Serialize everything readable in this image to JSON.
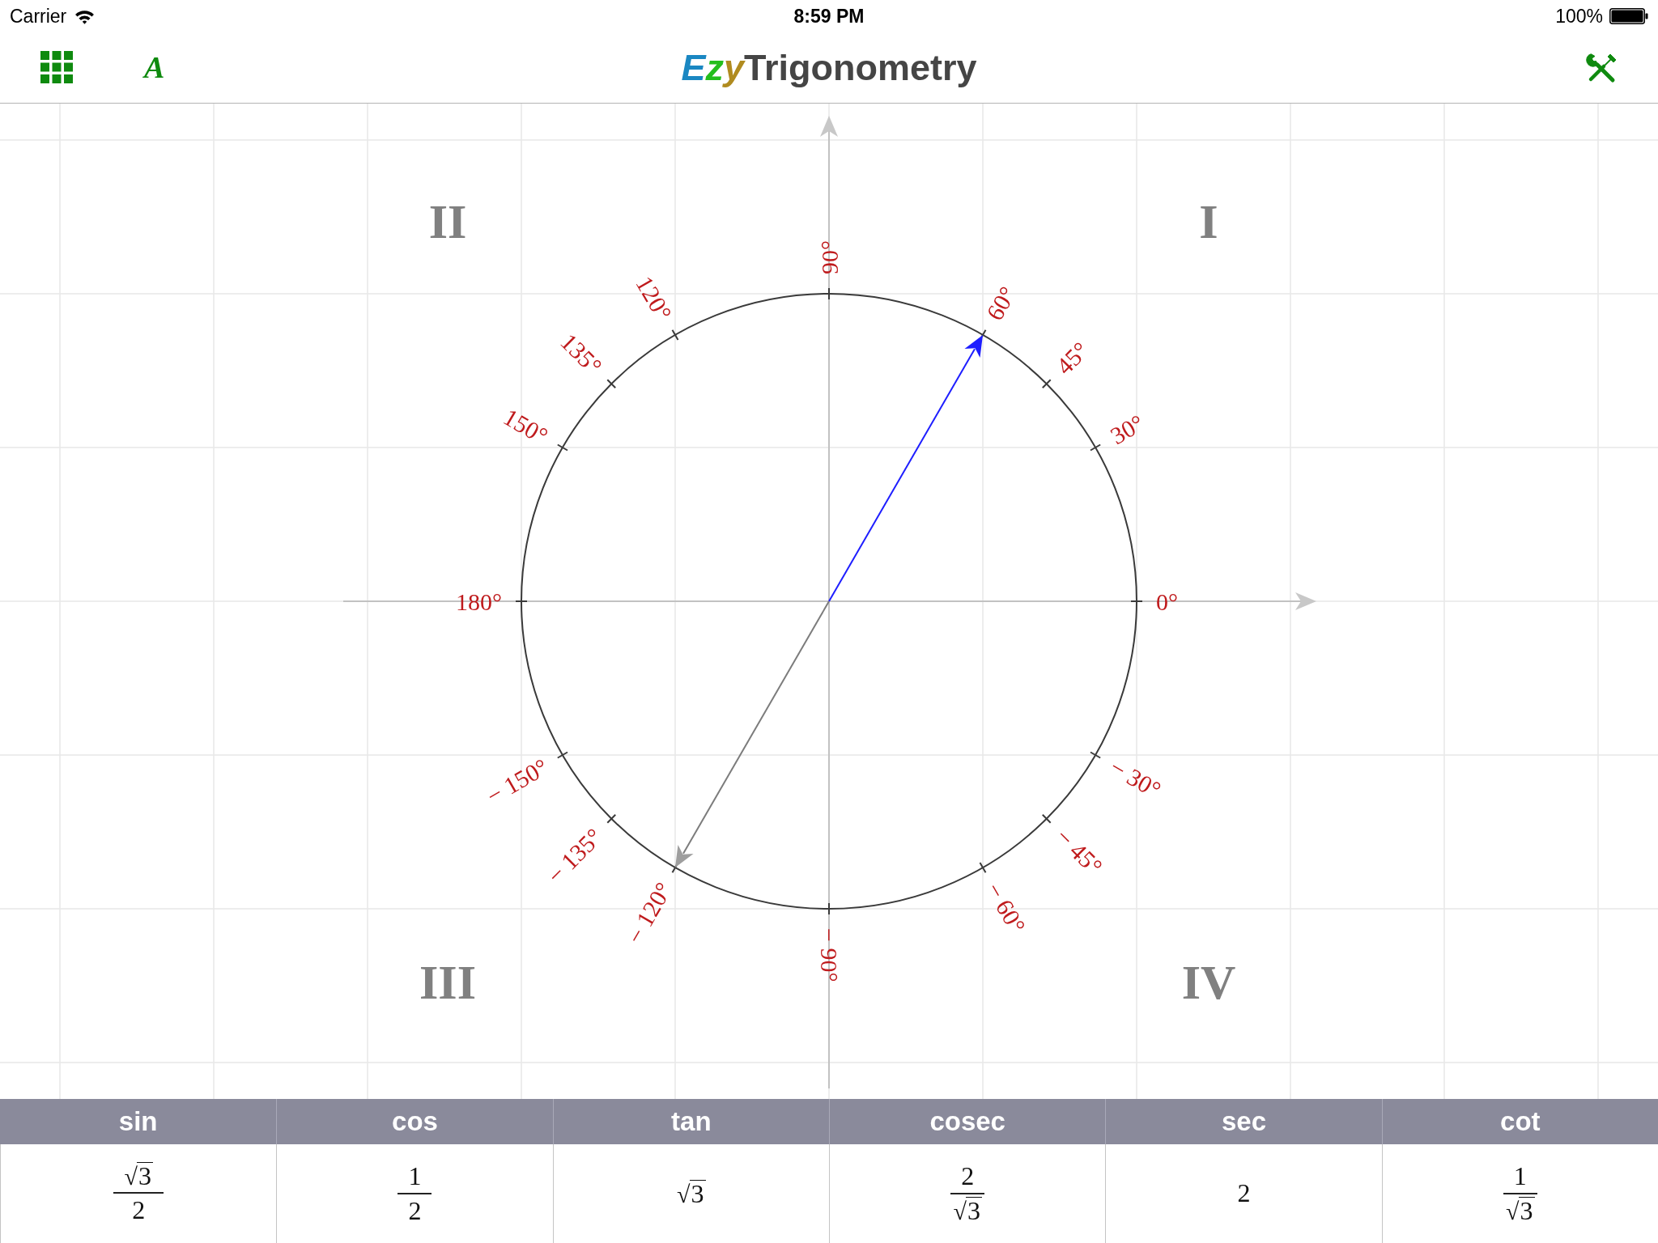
{
  "status_bar": {
    "carrier": "Carrier",
    "time": "8:59 PM",
    "battery": "100%"
  },
  "toolbar": {
    "font_button": "A",
    "title": {
      "accent": [
        {
          "text": "E",
          "color": "#1a87c2"
        },
        {
          "text": "z",
          "color": "#24be1c"
        },
        {
          "text": "y",
          "color": "#b08b1f"
        }
      ],
      "text": "Trigonometry"
    }
  },
  "diagram": {
    "quadrants": [
      {
        "label": "II"
      },
      {
        "label": "I"
      },
      {
        "label": "III"
      },
      {
        "label": "IV"
      }
    ],
    "angles": [
      {
        "label": "90°",
        "selected": false
      },
      {
        "label": "120°",
        "selected": false
      },
      {
        "label": "60°",
        "selected": true
      },
      {
        "label": "135°",
        "selected": false
      },
      {
        "label": "45°",
        "selected": false
      },
      {
        "label": "150°",
        "selected": false
      },
      {
        "label": "30°",
        "selected": false
      },
      {
        "label": "180°",
        "selected": false
      },
      {
        "label": "0°",
        "selected": false
      },
      {
        "label": "− 150°",
        "selected": false
      },
      {
        "label": "− 30°",
        "selected": false
      },
      {
        "label": "− 135°",
        "selected": false
      },
      {
        "label": "− 45°",
        "selected": false
      },
      {
        "label": "− 120°",
        "selected": false
      },
      {
        "label": "− 60°",
        "selected": false
      },
      {
        "label": "− 90°",
        "selected": false
      }
    ]
  },
  "table": {
    "columns": [
      "sin",
      "cos",
      "tan",
      "cosec",
      "sec",
      "cot"
    ],
    "values": [
      {
        "kind": "fraction",
        "numerator": {
          "sign": "√",
          "text": "3"
        },
        "denominator": {
          "text": "2"
        }
      },
      {
        "kind": "fraction",
        "numerator": {
          "text": "1"
        },
        "denominator": {
          "text": "2"
        }
      },
      {
        "kind": "number",
        "value": {
          "sign": "√",
          "text": "3"
        }
      },
      {
        "kind": "fraction",
        "numerator": {
          "text": "2"
        },
        "denominator": {
          "sign": "√",
          "text": "3"
        }
      },
      {
        "kind": "number",
        "value": {
          "text": "2"
        }
      },
      {
        "kind": "fraction",
        "numerator": {
          "text": "1"
        },
        "denominator": {
          "sign": "√",
          "text": "3"
        }
      }
    ]
  }
}
